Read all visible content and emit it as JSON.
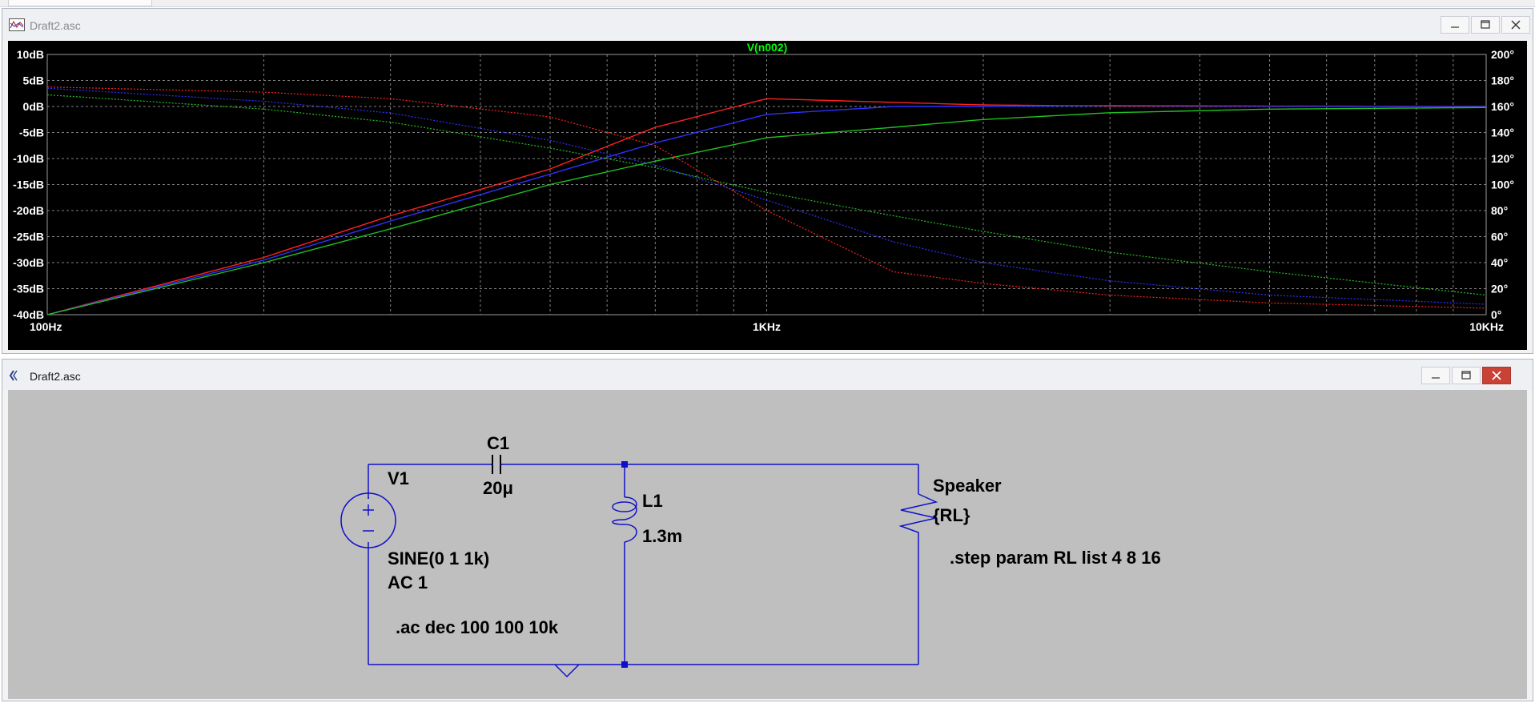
{
  "top_window": {
    "title": "Draft2.asc",
    "trace_label": "V(n002)",
    "trace_label_color": "#00ff00",
    "y_left_ticks": [
      "10dB",
      "5dB",
      "0dB",
      "-5dB",
      "-10dB",
      "-15dB",
      "-20dB",
      "-25dB",
      "-30dB",
      "-35dB",
      "-40dB"
    ],
    "y_right_ticks": [
      "200°",
      "180°",
      "160°",
      "140°",
      "120°",
      "100°",
      "80°",
      "60°",
      "40°",
      "20°",
      "0°"
    ],
    "x_ticks": [
      "100Hz",
      "1KHz",
      "10KHz"
    ]
  },
  "bottom_window": {
    "title": "Draft2.asc",
    "c1_name": "C1",
    "c1_value": "20μ",
    "v1_name": "V1",
    "v1_value": "SINE(0 1 1k)",
    "v1_ac": "AC 1",
    "ac_directive": ".ac dec 100 100 10k",
    "l1_name": "L1",
    "l1_value": "1.3m",
    "speaker_name": "Speaker",
    "speaker_value": "{RL}",
    "step_directive": ".step param RL list 4 8 16"
  },
  "window_buttons": {
    "minimize": "minimize-icon",
    "maximize": "maximize-icon",
    "close": "close-icon"
  },
  "colors": {
    "wire": "#1010c8",
    "background_schematic": "#bfbfbf",
    "plot_background": "#000000",
    "grid": "#8a8a8a"
  },
  "chart_data": {
    "type": "line",
    "title": "V(n002)",
    "x_scale": "log",
    "xlim": [
      100,
      10000
    ],
    "ylim_left": [
      -40,
      10
    ],
    "ylim_right": [
      0,
      200
    ],
    "grid": true,
    "series": [
      {
        "color": "#ff2020",
        "axis": "left",
        "style": "solid",
        "x": [
          100,
          200,
          300,
          500,
          700,
          1000,
          1500,
          2000,
          3000,
          5000,
          10000
        ],
        "y": [
          -40,
          -29,
          -21,
          -12,
          -4,
          1.5,
          0.8,
          0.3,
          0.1,
          0.05,
          0
        ]
      },
      {
        "color": "#3030ff",
        "axis": "left",
        "style": "solid",
        "x": [
          100,
          200,
          300,
          500,
          700,
          1000,
          1500,
          2000,
          3000,
          5000,
          10000
        ],
        "y": [
          -40,
          -29.5,
          -22,
          -13,
          -7,
          -1.5,
          0,
          0,
          0.2,
          0.1,
          0
        ]
      },
      {
        "color": "#20c020",
        "axis": "left",
        "style": "solid",
        "x": [
          100,
          200,
          300,
          500,
          700,
          1000,
          1500,
          2000,
          3000,
          5000,
          10000
        ],
        "y": [
          -40,
          -30,
          -23.5,
          -15,
          -10.5,
          -6,
          -4,
          -2.5,
          -1.2,
          -0.5,
          -0.2
        ]
      },
      {
        "color": "#ff2020",
        "axis": "right",
        "style": "dotted",
        "x": [
          100,
          200,
          300,
          500,
          700,
          1000,
          1500,
          2000,
          3000,
          5000,
          10000
        ],
        "y": [
          175,
          171,
          166,
          152,
          130,
          80,
          33,
          24,
          15,
          9,
          5
        ]
      },
      {
        "color": "#3030ff",
        "axis": "right",
        "style": "dotted",
        "x": [
          100,
          200,
          300,
          500,
          700,
          1000,
          1500,
          2000,
          3000,
          5000,
          10000
        ],
        "y": [
          174,
          164,
          155,
          134,
          115,
          88,
          56,
          40,
          26,
          15,
          8
        ]
      },
      {
        "color": "#20c020",
        "axis": "right",
        "style": "dotted",
        "x": [
          100,
          200,
          300,
          500,
          700,
          1000,
          1500,
          2000,
          3000,
          5000,
          10000
        ],
        "y": [
          169,
          158,
          148,
          128,
          113,
          94,
          76,
          64,
          48,
          33,
          15
        ]
      }
    ]
  }
}
